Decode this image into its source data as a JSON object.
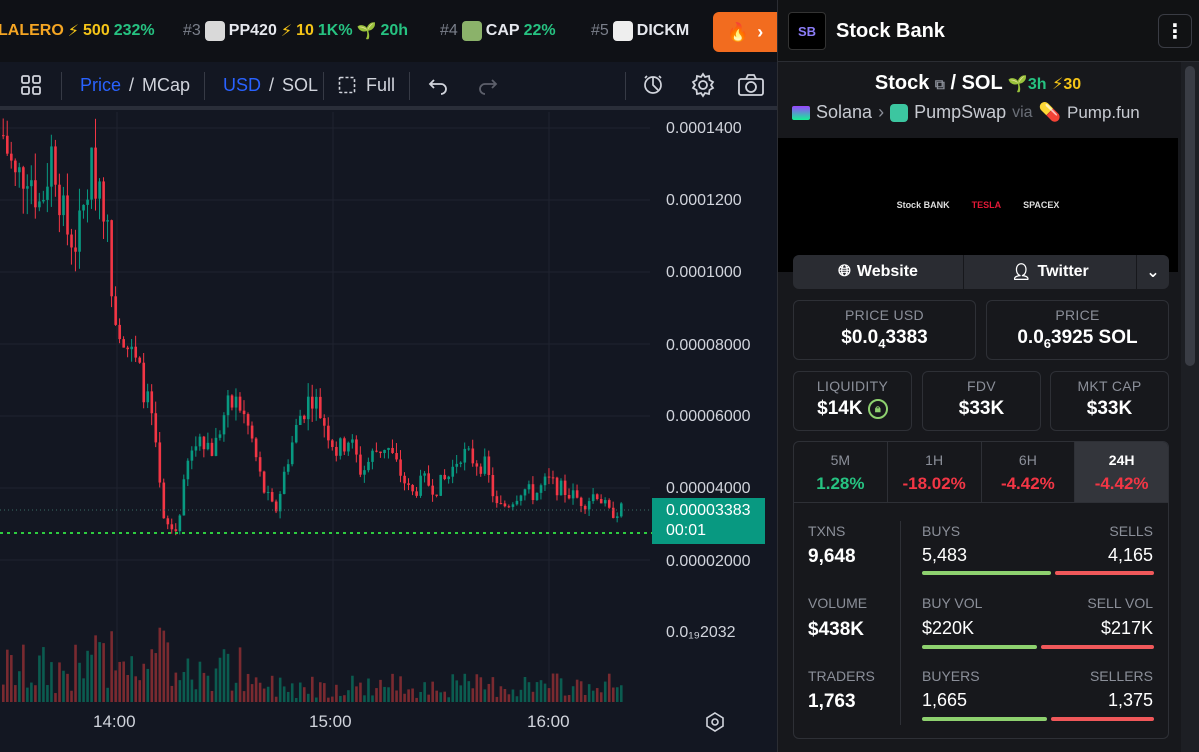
{
  "ticker": [
    {
      "rank": "",
      "name": "LALERO",
      "boosts": "500",
      "change": "232%",
      "age": ""
    },
    {
      "rank": "#3",
      "name": "PP420",
      "boosts": "10",
      "change": "1K%",
      "age": "20h"
    },
    {
      "rank": "#4",
      "name": "CAP",
      "boosts": "",
      "change": "22%",
      "age": ""
    },
    {
      "rank": "#5",
      "name": "DICKM",
      "boosts": "",
      "change": "",
      "age": ""
    }
  ],
  "toolbar": {
    "price_label": "Price",
    "mcap_label": "MCap",
    "usd_label": "USD",
    "sol_label": "SOL",
    "full_label": "Full",
    "slash": "/"
  },
  "chart_data": {
    "type": "candlestick",
    "y_ticks": [
      "0.0001400",
      "0.0001200",
      "0.0001000",
      "0.00008000",
      "0.00006000",
      "0.00004000",
      "0.00002000"
    ],
    "volume_tick": "0.0₁₉2032",
    "x_ticks": [
      "14:00",
      "15:00",
      "16:00"
    ],
    "last_price": "0.00003383",
    "countdown": "00:01",
    "ylim": [
      1.2e-05,
      0.00015
    ],
    "close_path": [
      0.000138,
      0.000125,
      0.00013,
      0.000118,
      0.000135,
      0.000112,
      0.000108,
      0.000128,
      0.000125,
      9e-05,
      8e-05,
      7.2e-05,
      6e-05,
      3e-05,
      2.8e-05,
      4.8e-05,
      5.5e-05,
      5e-05,
      6.2e-05,
      6.4e-05,
      5.5e-05,
      4e-05,
      3.3e-05,
      4.8e-05,
      6e-05,
      6.6e-05,
      5.8e-05,
      5e-05,
      5.4e-05,
      4.4e-05,
      5e-05,
      5.2e-05,
      4.5e-05,
      3.8e-05,
      4.2e-05,
      4e-05,
      4.3e-05,
      5e-05,
      4.8e-05,
      4.6e-05,
      3.4e-05,
      3.6e-05,
      4e-05,
      3.8e-05,
      4.2e-05,
      4e-05,
      3.8e-05,
      3.6e-05,
      3.9e-05,
      3.3e-05,
      3.4e-05
    ]
  },
  "panel": {
    "title": "Stock Bank",
    "logo_text": "SB",
    "pair_base": "Stock",
    "pair_quote": "SOL",
    "age": "3h",
    "boosts": "30",
    "chain": "Solana",
    "dex": "PumpSwap",
    "via": "via",
    "launchpad": "Pump.fun",
    "banner_items": [
      "Stock BANK",
      "TESLA",
      "SPACEX"
    ],
    "website_label": "Website",
    "twitter_label": "Twitter",
    "price_usd_label": "PRICE USD",
    "price_usd_a": "$0.0",
    "price_usd_sub": "4",
    "price_usd_b": "3383",
    "price_label": "PRICE",
    "price_sol_a": "0.0",
    "price_sol_sub": "6",
    "price_sol_b": "3925 SOL",
    "liquidity_label": "LIQUIDITY",
    "liquidity": "$14K",
    "fdv_label": "FDV",
    "fdv": "$33K",
    "mcap_label": "MKT CAP",
    "mcap": "$33K",
    "timeframes": [
      {
        "label": "5M",
        "value": "1.28%"
      },
      {
        "label": "1H",
        "value": "-18.02%"
      },
      {
        "label": "6H",
        "value": "-4.42%"
      },
      {
        "label": "24H",
        "value": "-4.42%"
      }
    ],
    "txns_label": "TXNS",
    "txns": "9,648",
    "buys_label": "BUYS",
    "buys": "5,483",
    "sells_label": "SELLS",
    "sells": "4,165",
    "volume_label": "VOLUME",
    "volume": "$438K",
    "buy_vol_label": "BUY VOL",
    "buy_vol": "$220K",
    "sell_vol_label": "SELL VOL",
    "sell_vol": "$217K",
    "traders_label": "TRADERS",
    "traders": "1,763",
    "buyers_label": "BUYERS",
    "buyers": "1,665",
    "sellers_label": "SELLERS",
    "sellers": "1,375"
  },
  "colors": {
    "up": "#089981",
    "down": "#f23645",
    "accent": "#2962ff",
    "hot": "#f26c1f"
  }
}
